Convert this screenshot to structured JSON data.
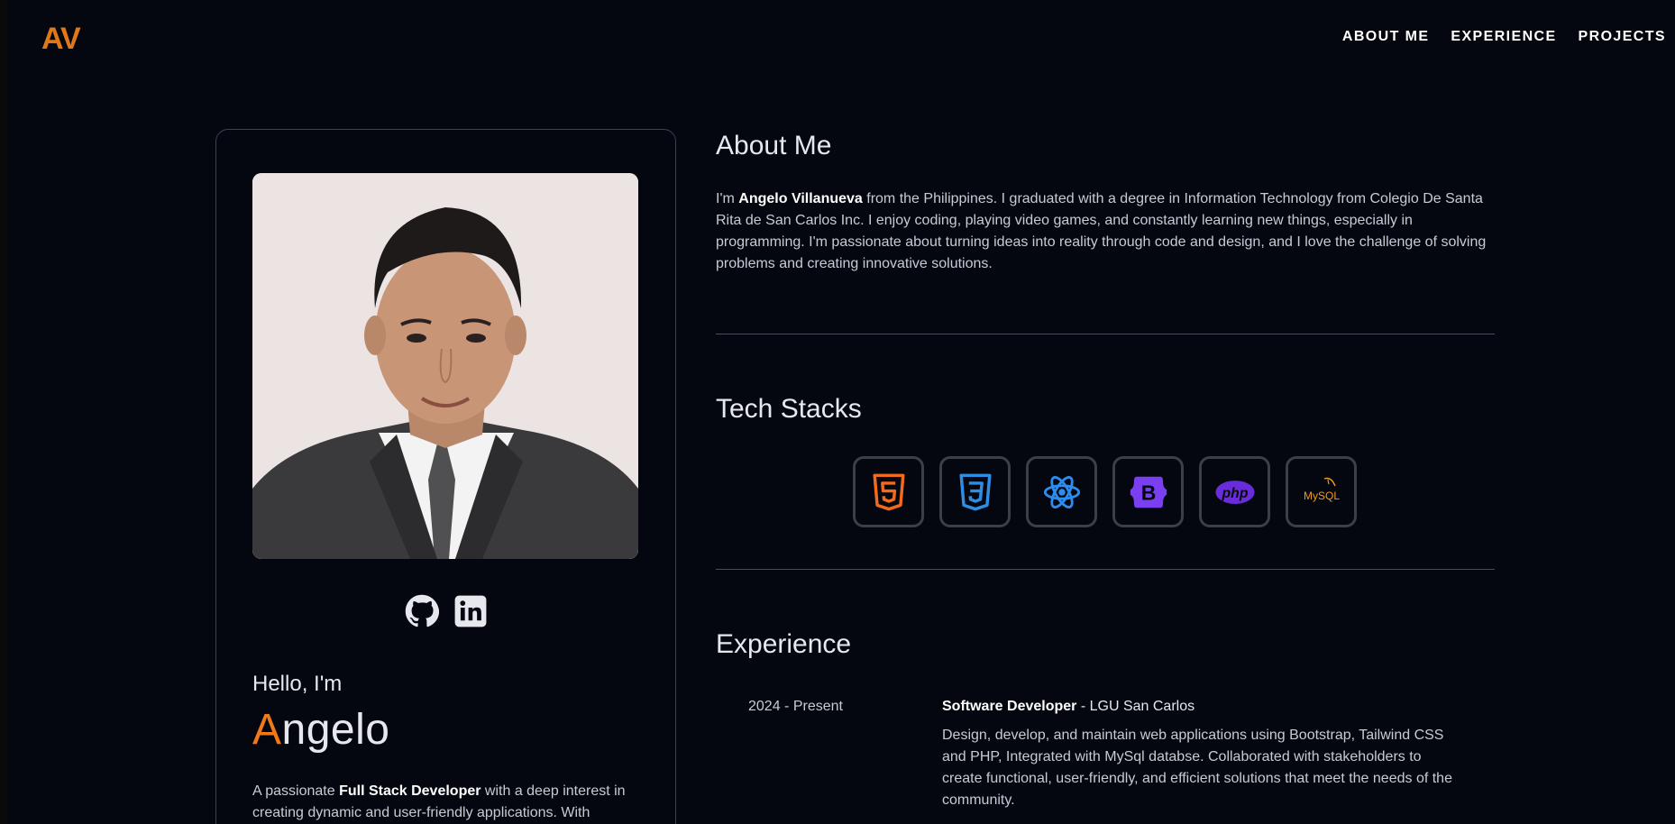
{
  "header": {
    "logo": "AV",
    "nav": [
      "ABOUT ME",
      "EXPERIENCE",
      "PROJECTS"
    ]
  },
  "profile": {
    "hello": "Hello, I'm",
    "name_first": "A",
    "name_rest": "ngelo",
    "intro_pre": "A passionate ",
    "intro_bold": "Full Stack Developer",
    "intro_post": " with a deep interest in creating dynamic and user-friendly applications. With",
    "socials": [
      "github-icon",
      "linkedin-icon"
    ]
  },
  "about": {
    "title": "About Me",
    "pre": "I'm ",
    "name": "Angelo Villanueva",
    "text": " from the Philippines. I graduated with a degree in Information Technology from Colegio De Santa Rita de San Carlos Inc. I enjoy coding, playing video games, and constantly learning new things, especially in programming. I'm passionate about turning ideas into reality through code and design, and I love the challenge of solving problems and creating innovative solutions."
  },
  "tech": {
    "title": "Tech Stacks",
    "items": [
      "html5-icon",
      "css3-icon",
      "react-icon",
      "bootstrap-icon",
      "php-icon",
      "mysql-icon"
    ],
    "bootstrap_letter": "B",
    "php_label": "php",
    "mysql_label": "MySQL",
    "colors": {
      "html": "#f26a1b",
      "css": "#2f8de4",
      "react": "#2d8cf0",
      "bootstrap": "#7b3ff2",
      "php": "#6a2bd8",
      "mysql": "#f09c1e"
    }
  },
  "experience": {
    "title": "Experience",
    "items": [
      {
        "date": "2024 - Present",
        "role": "Software Developer",
        "org": " - LGU San Carlos",
        "desc": "Design, develop, and maintain web applications using Bootstrap, Tailwind CSS and PHP, Integrated with MySql databse. Collaborated with stakeholders to create functional, user-friendly, and efficient solutions that meet the needs of the community."
      }
    ]
  }
}
